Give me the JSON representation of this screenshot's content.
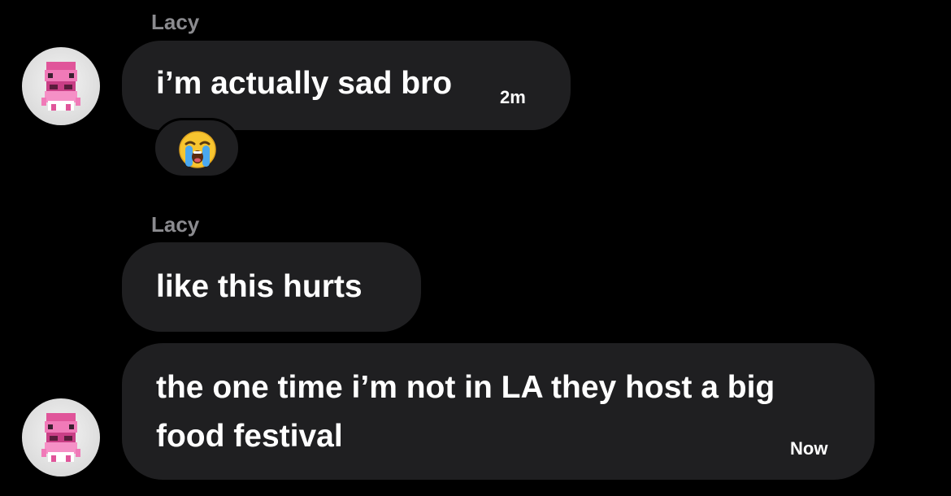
{
  "conversation": {
    "messages": [
      {
        "sender": "Lacy",
        "text": "i’m actually sad bro",
        "time": "2m",
        "reaction_icon": "loudly-crying-face-icon"
      },
      {
        "sender": "Lacy",
        "text": "like this hurts"
      },
      {
        "text_line1": "the one time i’m not in LA they host a big",
        "text_line2": "food festival",
        "time": "Now"
      }
    ],
    "avatar_icon": "pink-pixel-character-avatar"
  },
  "colors": {
    "background": "#000000",
    "bubble": "#1f1f21",
    "sender_name": "#8b8b8f",
    "text": "#ffffff"
  }
}
